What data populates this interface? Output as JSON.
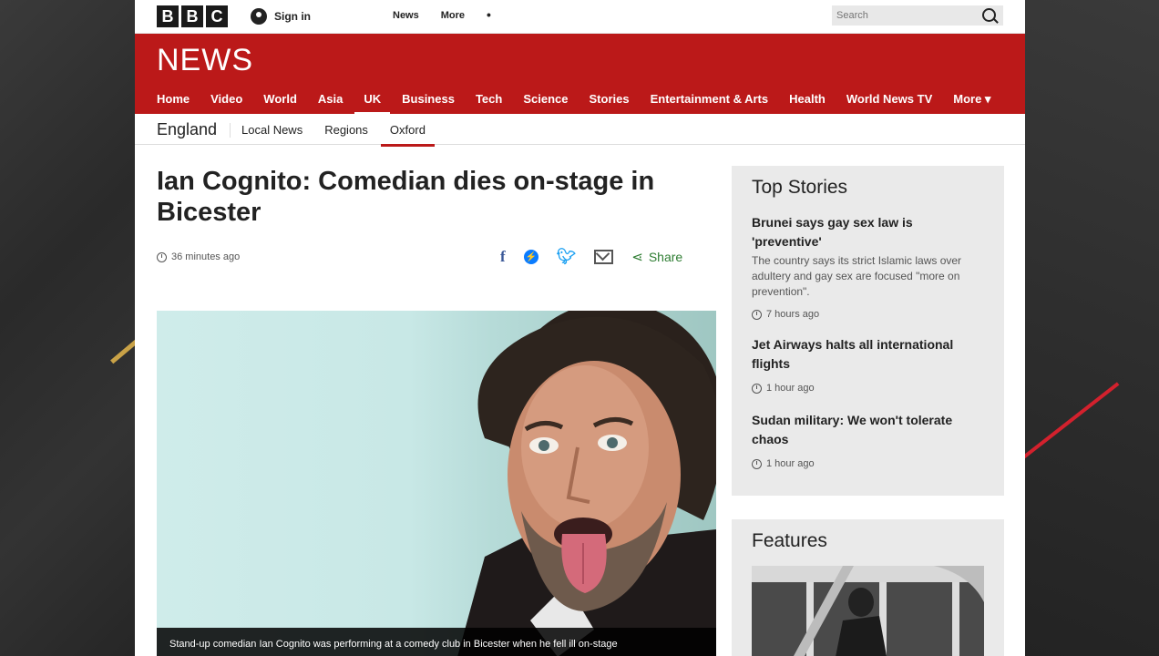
{
  "topbar": {
    "logo_letters": [
      "B",
      "B",
      "C"
    ],
    "signin_label": "Sign in",
    "nav": [
      "News",
      "More",
      "•"
    ],
    "search_placeholder": "Search"
  },
  "header": {
    "logo": "NEWS",
    "nav": [
      "Home",
      "Video",
      "World",
      "Asia",
      "UK",
      "Business",
      "Tech",
      "Science",
      "Stories",
      "Entertainment & Arts",
      "Health",
      "World News TV",
      "More ▾"
    ],
    "active": "UK"
  },
  "subnav": {
    "region": "England",
    "links": [
      "Local News",
      "Regions",
      "Oxford"
    ],
    "active": "Oxford"
  },
  "article": {
    "headline": "Ian Cognito: Comedian dies on-stage in Bicester",
    "timestamp": "36 minutes ago",
    "share_label": "Share",
    "caption": "Stand-up comedian Ian Cognito was performing at a comedy club in Bicester when he fell ill on-stage"
  },
  "top_stories": {
    "title": "Top Stories",
    "items": [
      {
        "headline": "Brunei says gay sex law is 'preventive'",
        "summary": "The country says its strict Islamic laws over adultery and gay sex are focused \"more on prevention\".",
        "time": "7 hours ago"
      },
      {
        "headline": "Jet Airways halts all international flights",
        "summary": "",
        "time": "1 hour ago"
      },
      {
        "headline": "Sudan military: We won't tolerate chaos",
        "summary": "",
        "time": "1 hour ago"
      }
    ]
  },
  "features": {
    "title": "Features"
  },
  "colors": {
    "bbc_red": "#bb1919",
    "share_green": "#2e7d32"
  }
}
